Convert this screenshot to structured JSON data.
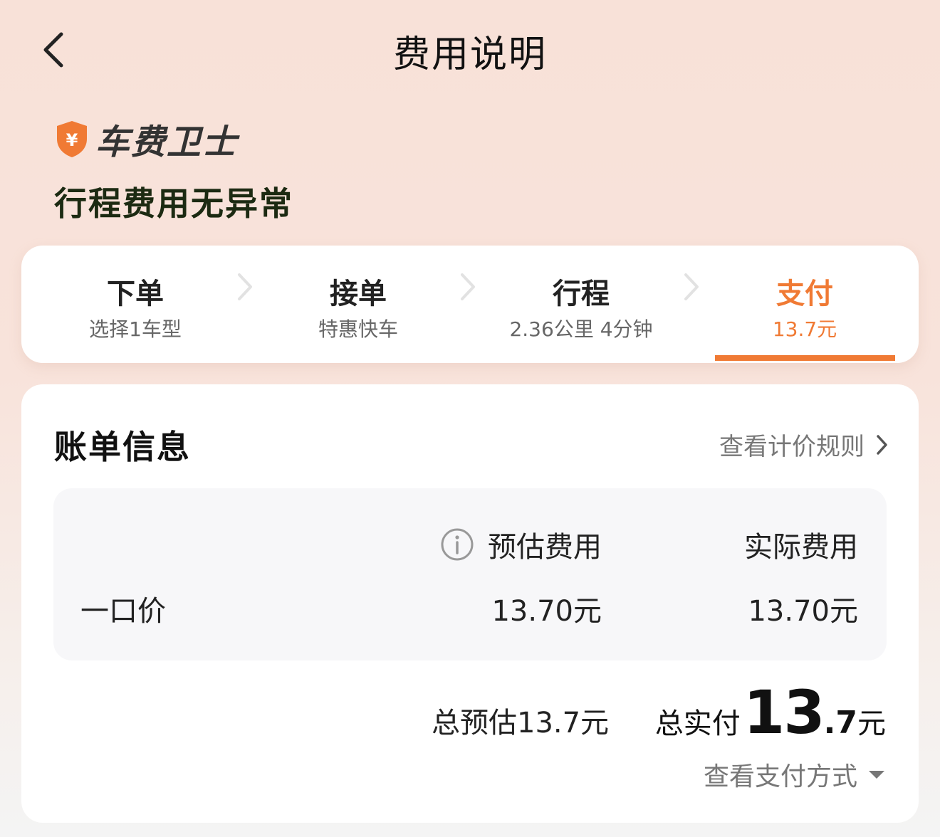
{
  "header": {
    "title": "费用说明"
  },
  "brand": {
    "name": "车费卫士",
    "shield_symbol": "¥",
    "shield_color": "#f07a34"
  },
  "headline": "行程费用无异常",
  "steps": [
    {
      "title": "下单",
      "sub": "选择1车型"
    },
    {
      "title": "接单",
      "sub": "特惠快车"
    },
    {
      "title": "行程",
      "sub": "2.36公里 4分钟"
    },
    {
      "title": "支付",
      "sub": "13.7元",
      "active": true
    }
  ],
  "bill": {
    "title": "账单信息",
    "rules_link": "查看计价规则",
    "columns": {
      "estimated": "预估费用",
      "actual": "实际费用"
    },
    "rows": [
      {
        "label": "一口价",
        "estimated": "13.70元",
        "actual": "13.70元"
      }
    ],
    "total_estimated": "总预估13.7元",
    "total_actual_label": "总实付",
    "total_actual_int": "13",
    "total_actual_dec": ".7",
    "total_actual_unit": "元",
    "pay_method_link": "查看支付方式"
  },
  "colors": {
    "accent": "#f07a34",
    "headline": "#1c2a12"
  }
}
